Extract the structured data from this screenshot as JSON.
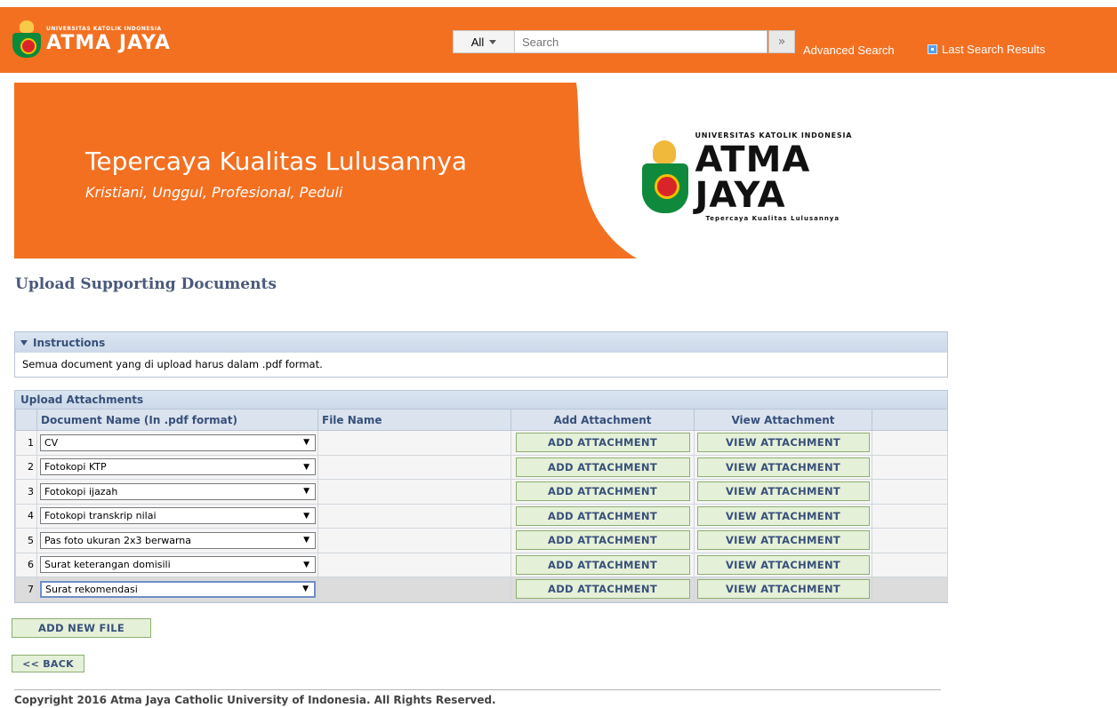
{
  "header": {
    "logo_small": "UNIVERSITAS KATOLIK INDONESIA",
    "logo_big": "ATMA JAYA",
    "search_category": "All",
    "search_placeholder": "Search",
    "advanced_search": "Advanced Search",
    "last_search_results": "Last Search Results"
  },
  "banner": {
    "title": "Tepercaya Kualitas Lulusannya",
    "subtitle": "Kristiani, Unggul, Profesional, Peduli",
    "logo_small": "UNIVERSITAS KATOLIK INDONESIA",
    "logo_big": "ATMA JAYA",
    "logo_tagline": "Tepercaya Kualitas Lulusannya",
    "color": "#f37021"
  },
  "page": {
    "title": "Upload Supporting Documents"
  },
  "instructions": {
    "heading": "Instructions",
    "text": "Semua document yang di upload harus dalam .pdf format."
  },
  "attachments": {
    "heading": "Upload Attachments",
    "columns": {
      "document_name": "Document Name (In .pdf format)",
      "file_name": "File Name",
      "add_attachment": "Add Attachment",
      "view_attachment": "View Attachment"
    },
    "add_label": "ADD ATTACHMENT",
    "view_label": "VIEW ATTACHMENT",
    "rows": [
      {
        "num": "1",
        "doc": "CV",
        "file": ""
      },
      {
        "num": "2",
        "doc": "Fotokopi KTP",
        "file": ""
      },
      {
        "num": "3",
        "doc": "Fotokopi ijazah",
        "file": ""
      },
      {
        "num": "4",
        "doc": "Fotokopi transkrip nilai",
        "file": ""
      },
      {
        "num": "5",
        "doc": "Pas foto ukuran 2x3 berwarna",
        "file": ""
      },
      {
        "num": "6",
        "doc": "Surat keterangan domisili",
        "file": ""
      },
      {
        "num": "7",
        "doc": "Surat rekomendasi",
        "file": ""
      }
    ]
  },
  "actions": {
    "add_new_file": "ADD NEW FILE",
    "back": "<< BACK"
  },
  "footer": {
    "copyright": "Copyright 2016 Atma Jaya Catholic University of Indonesia. All Rights Reserved."
  }
}
